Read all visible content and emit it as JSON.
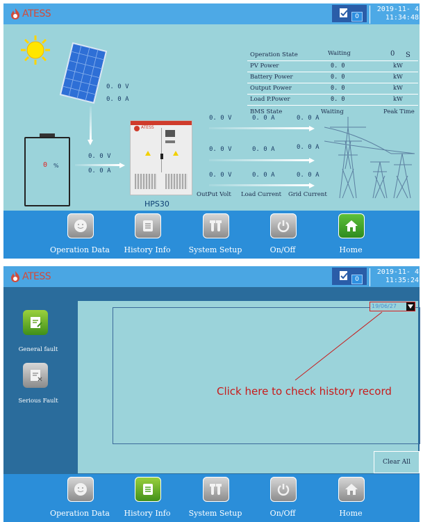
{
  "brand": "ATESS",
  "screen1": {
    "date": "2019-11- 4",
    "time": "11:34:48",
    "notifications": "0",
    "table": {
      "rows": [
        {
          "label": "Operation State",
          "value": "Waiting",
          "value2": "0",
          "unit": "S"
        },
        {
          "label": "PV Power",
          "value": "0. 0",
          "unit": "kW"
        },
        {
          "label": "Battery Power",
          "value": "0. 0",
          "unit": "kW"
        },
        {
          "label": "Output Power",
          "value": "0. 0",
          "unit": "kW"
        },
        {
          "label": "Load P.Power",
          "value": "0. 0",
          "unit": "kW"
        },
        {
          "label": "BMS State",
          "value": "Waiting",
          "unit": "Peak Time"
        }
      ]
    },
    "pv_voltage": "0. 0  V",
    "pv_current": "0. 0  A",
    "battery_percent": "0",
    "battery_percent_unit": "%",
    "battery_voltage": "0. 0  V",
    "battery_current": "0. 0  A",
    "inverter_model": "HPS30",
    "inverter_brand": "ATESS",
    "output_rows": [
      {
        "volt": "0. 0  V",
        "load": "0. 0  A",
        "grid": "0. 0  A"
      },
      {
        "volt": "0. 0  V",
        "load": "0. 0  A",
        "grid": "0. 0  A"
      },
      {
        "volt": "0. 0  V",
        "load": "0. 0  A",
        "grid": "0. 0  A"
      }
    ],
    "output_labels": {
      "volt": "OutPut Volt",
      "load": "Load Current",
      "grid": "Grid Current"
    }
  },
  "screen2": {
    "date": "2019-11- 4",
    "time": "11:35:24",
    "notifications": "0",
    "general_fault_label": "General fault",
    "serious_fault_label": "Serious Fault",
    "date_select_value": "19/06/27",
    "callout": "Click here to check history record",
    "clear_all": "Clear All"
  },
  "nav": {
    "items": [
      {
        "label": "Operation Data",
        "icon": "smiley-icon"
      },
      {
        "label": "History Info",
        "icon": "list-icon"
      },
      {
        "label": "System Setup",
        "icon": "tools-icon"
      },
      {
        "label": "On/Off",
        "icon": "power-icon"
      },
      {
        "label": "Home",
        "icon": "home-icon"
      }
    ]
  },
  "colors": {
    "topbar": "#4da9e6",
    "main_bg": "#9bd3da",
    "nav_bg": "#2b8ed9",
    "active_green": "#4ca21f",
    "callout_red": "#c81b1b"
  }
}
